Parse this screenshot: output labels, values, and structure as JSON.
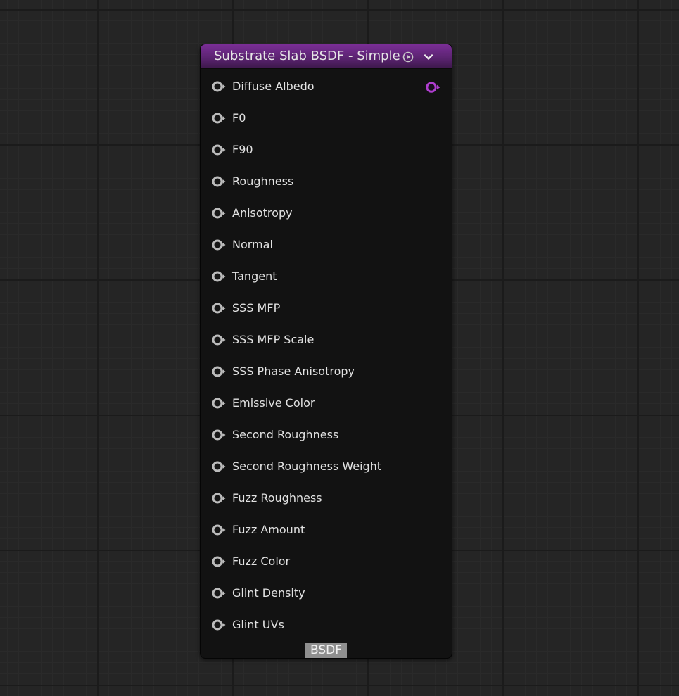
{
  "node": {
    "title": "Substrate Slab BSDF - Simple",
    "accent_color": "#8a35a8",
    "inputs": [
      {
        "label": "Diffuse Albedo"
      },
      {
        "label": "F0"
      },
      {
        "label": "F90"
      },
      {
        "label": "Roughness"
      },
      {
        "label": "Anisotropy"
      },
      {
        "label": "Normal"
      },
      {
        "label": "Tangent"
      },
      {
        "label": "SSS MFP"
      },
      {
        "label": "SSS MFP Scale"
      },
      {
        "label": "SSS Phase Anisotropy"
      },
      {
        "label": "Emissive Color"
      },
      {
        "label": "Second Roughness"
      },
      {
        "label": "Second Roughness Weight"
      },
      {
        "label": "Fuzz Roughness"
      },
      {
        "label": "Fuzz Amount"
      },
      {
        "label": "Fuzz Color"
      },
      {
        "label": "Glint Density"
      },
      {
        "label": "Glint UVs"
      }
    ],
    "output": {
      "label": "BSDF",
      "pin_icon": "output-pin-icon"
    },
    "header_icons": [
      "preview-play-icon",
      "chevron-down-icon"
    ]
  }
}
